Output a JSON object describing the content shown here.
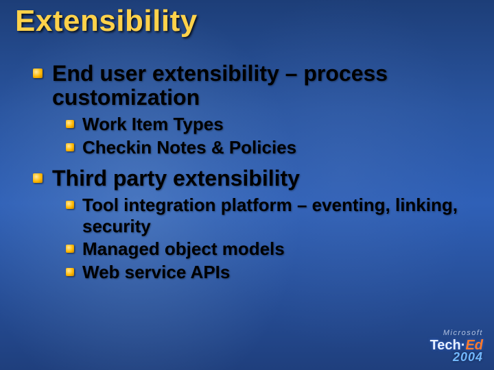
{
  "title": "Extensibility",
  "items": [
    {
      "text": "End user extensibility – process customization",
      "sub": [
        "Work Item Types",
        "Checkin Notes & Policies"
      ]
    },
    {
      "text": "Third party extensibility",
      "sub": [
        "Tool integration platform – eventing, linking, security",
        "Managed object models",
        "Web service APIs"
      ]
    }
  ],
  "footer": {
    "company": "Microsoft",
    "brand_prefix": "Tech·",
    "brand_accent": "Ed",
    "year": "2004"
  }
}
